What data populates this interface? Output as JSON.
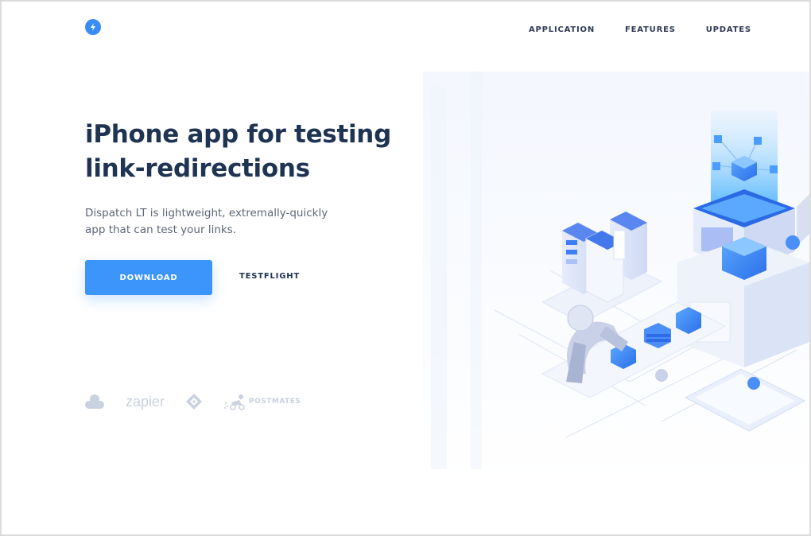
{
  "header": {
    "logo_icon": "lightning-bolt-icon",
    "nav": [
      {
        "label": "APPLICATION"
      },
      {
        "label": "FEATURES"
      },
      {
        "label": "UPDATES"
      }
    ]
  },
  "hero": {
    "title_line1": "iPhone app for testing",
    "title_line2": "link-redirections",
    "subtitle_line1": "Dispatch LT is lightweight, extremally-quickly",
    "subtitle_line2": "app that can test your links.",
    "download_label": "DOWNLOAD",
    "testflight_label": "TESTFLIGHT"
  },
  "partners": {
    "zapier": "zapier",
    "postmates": "POSTMATES"
  },
  "colors": {
    "accent": "#3b95fb",
    "heading": "#1f3352",
    "muted": "#c9d2de"
  }
}
